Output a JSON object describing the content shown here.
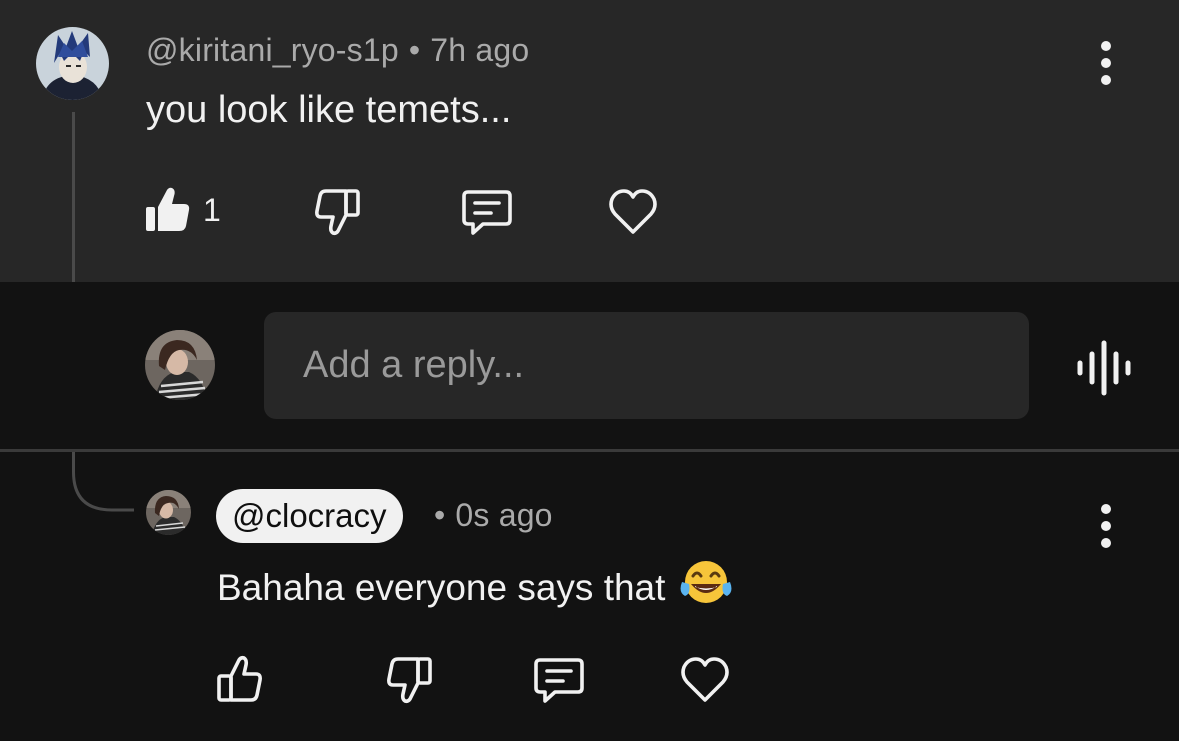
{
  "parent_comment": {
    "author": "@kiritani_ryo-s1p",
    "separator": "•",
    "time": "7h ago",
    "text": "you look like temets...",
    "like_count": "1",
    "liked": true
  },
  "reply_composer": {
    "placeholder": "Add a reply..."
  },
  "reply_comment": {
    "author": "@clocracy",
    "separator": "•",
    "time": "0s ago",
    "text": "Bahaha everyone says that",
    "emoji": "face-with-tears-of-joy",
    "liked": false
  },
  "icons": {
    "like": "thumbs-up-icon",
    "dislike": "thumbs-down-icon",
    "reply": "reply-comment-icon",
    "heart": "heart-icon",
    "more": "more-vertical-icon",
    "voice": "voice-search-icon"
  },
  "colors": {
    "background": "#121212",
    "highlight": "#272727",
    "text_primary": "#f1f1f1",
    "text_secondary": "#aaaaaa",
    "chip_background": "#f1f1f1"
  }
}
